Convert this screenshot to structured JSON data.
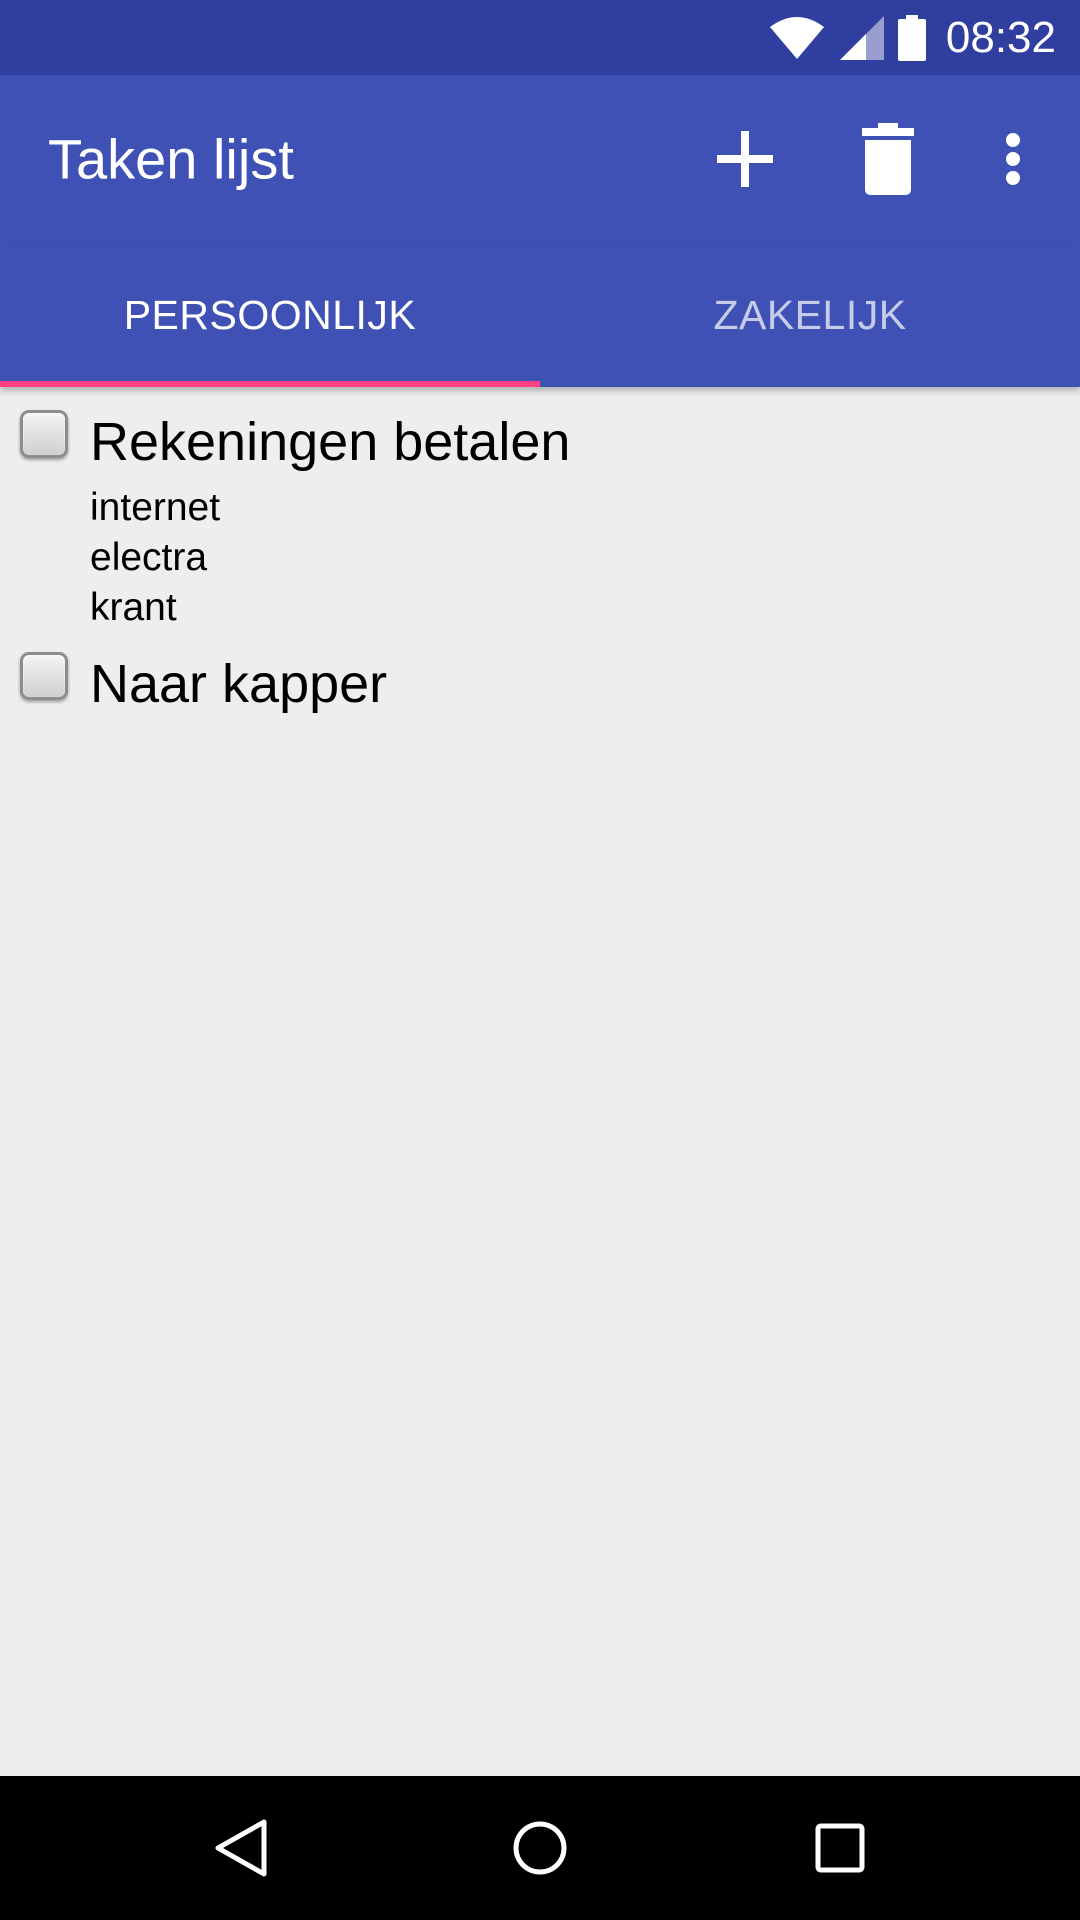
{
  "status_bar": {
    "time": "08:32",
    "icons": [
      "wifi-icon",
      "cell-signal-icon",
      "battery-icon"
    ]
  },
  "app_bar": {
    "title": "Taken lijst",
    "actions": [
      "add-icon",
      "delete-icon",
      "more-vert-icon"
    ],
    "color": "#3f51b5"
  },
  "tabs": [
    {
      "label": "PERSOONLIJK",
      "selected": true
    },
    {
      "label": "ZAKELIJK",
      "selected": false
    }
  ],
  "tasks": [
    {
      "title": "Rekeningen betalen",
      "checked": false,
      "notes": [
        "internet",
        "electra",
        "krant"
      ]
    },
    {
      "title": "Naar kapper",
      "checked": false,
      "notes": []
    }
  ],
  "nav_bar": {
    "buttons": [
      "back-icon",
      "home-icon",
      "recents-icon"
    ]
  },
  "colors": {
    "status_bar": "#303f9f",
    "primary": "#3f51b5",
    "accent": "#ff4081",
    "background": "#eeeeee"
  }
}
